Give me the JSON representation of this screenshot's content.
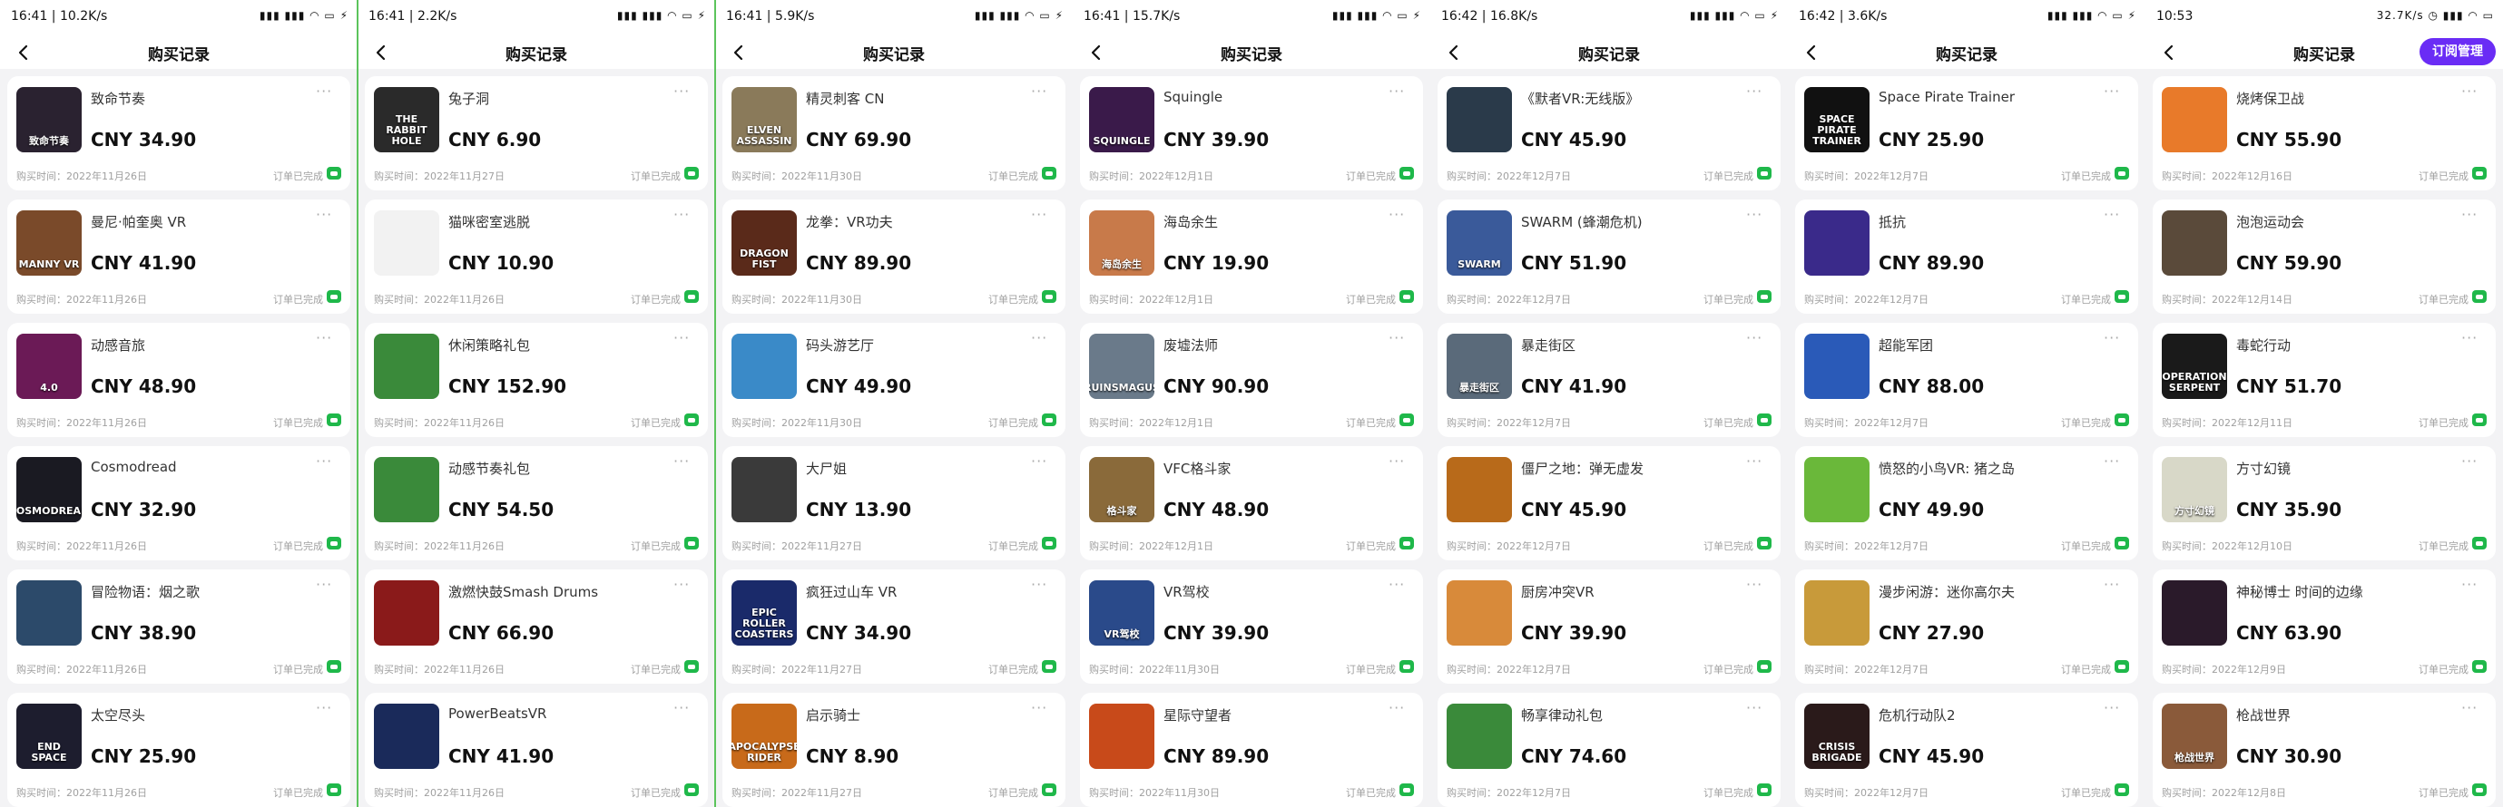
{
  "labels": {
    "page_title": "购买记录",
    "purchase_time_prefix": "购买时间：",
    "order_status": "订单已完成",
    "subscription_button": "订阅管理"
  },
  "colors": {
    "accent_purple": "#6a2cf5",
    "status_green": "#1fb84a",
    "divider_green": "#5cc45c"
  },
  "icons": {
    "back": "back-arrow-icon",
    "more": "more-dots-icon",
    "order_status": "chat-bubble-icon"
  },
  "screens": [
    {
      "status_time": "16:41 | 10.2K/s",
      "status_icons": "▮▮▮ ▮▮▮ ◠ ▭ ⚡",
      "items": [
        {
          "name": "致命节奏",
          "price": "CNY 34.90",
          "date": "2022年11月26日",
          "thumb_text": "致命节奏",
          "thumb_bg": "#2a2230"
        },
        {
          "name": "曼尼·帕奎奥 VR",
          "price": "CNY 41.90",
          "date": "2022年11月26日",
          "thumb_text": "MANNY VR",
          "thumb_bg": "#7a4a2a"
        },
        {
          "name": "动感音旅",
          "price": "CNY 48.90",
          "date": "2022年11月26日",
          "thumb_text": "4.0",
          "thumb_bg": "#6b1a56"
        },
        {
          "name": "Cosmodread",
          "price": "CNY 32.90",
          "date": "2022年11月26日",
          "thumb_text": "COSMODREAD",
          "thumb_bg": "#1a1a22"
        },
        {
          "name": "冒险物语：烟之歌",
          "price": "CNY 38.90",
          "date": "2022年11月26日",
          "thumb_text": "",
          "thumb_bg": "#2c4a6a"
        },
        {
          "name": "太空尽头",
          "price": "CNY 25.90",
          "date": "2022年11月26日",
          "thumb_text": "END SPACE",
          "thumb_bg": "#1d1d2e"
        }
      ]
    },
    {
      "status_time": "16:41 | 2.2K/s",
      "status_icons": "▮▮▮ ▮▮▮ ◠ ▭ ⚡",
      "items": [
        {
          "name": "兔子洞",
          "price": "CNY 6.90",
          "date": "2022年11月27日",
          "thumb_text": "THE RABBIT HOLE",
          "thumb_bg": "#2a2a2a"
        },
        {
          "name": "猫咪密室逃脱",
          "price": "CNY 10.90",
          "date": "2022年11月26日",
          "thumb_text": "",
          "thumb_bg": "#f2f2f2"
        },
        {
          "name": "休闲策略礼包",
          "price": "CNY 152.90",
          "date": "2022年11月26日",
          "thumb_text": "",
          "thumb_bg": "#3a8a3a"
        },
        {
          "name": "动感节奏礼包",
          "price": "CNY 54.50",
          "date": "2022年11月26日",
          "thumb_text": "",
          "thumb_bg": "#3a8a3a"
        },
        {
          "name": "激燃快鼓Smash Drums",
          "price": "CNY 66.90",
          "date": "2022年11月26日",
          "thumb_text": "",
          "thumb_bg": "#8a1a1a"
        },
        {
          "name": "PowerBeatsVR",
          "price": "CNY 41.90",
          "date": "2022年11月26日",
          "thumb_text": "",
          "thumb_bg": "#1a2a5a"
        }
      ]
    },
    {
      "status_time": "16:41 | 5.9K/s",
      "status_icons": "▮▮▮ ▮▮▮ ◠ ▭ ⚡",
      "items": [
        {
          "name": "精灵刺客 CN",
          "price": "CNY 69.90",
          "date": "2022年11月30日",
          "thumb_text": "ELVEN ASSASSIN",
          "thumb_bg": "#8a7a5a"
        },
        {
          "name": "龙拳：VR功夫",
          "price": "CNY 89.90",
          "date": "2022年11月30日",
          "thumb_text": "DRAGON FIST",
          "thumb_bg": "#5a2a1a"
        },
        {
          "name": "码头游艺厅",
          "price": "CNY 49.90",
          "date": "2022年11月30日",
          "thumb_text": "",
          "thumb_bg": "#3a8ac8"
        },
        {
          "name": "大尸姐",
          "price": "CNY 13.90",
          "date": "2022年11月27日",
          "thumb_text": "",
          "thumb_bg": "#3a3a3a"
        },
        {
          "name": "疯狂过山车 VR",
          "price": "CNY 34.90",
          "date": "2022年11月27日",
          "thumb_text": "EPIC ROLLER COASTERS",
          "thumb_bg": "#1a2a6a"
        },
        {
          "name": "启示骑士",
          "price": "CNY 8.90",
          "date": "2022年11月27日",
          "thumb_text": "APOCALYPSE RIDER",
          "thumb_bg": "#c86a1a"
        }
      ]
    },
    {
      "status_time": "16:41 | 15.7K/s",
      "status_icons": "▮▮▮ ▮▮▮ ◠ ▭ ⚡",
      "items": [
        {
          "name": "Squingle",
          "price": "CNY 39.90",
          "date": "2022年12月1日",
          "thumb_text": "SQUINGLE",
          "thumb_bg": "#3a1a4a"
        },
        {
          "name": "海岛余生",
          "price": "CNY 19.90",
          "date": "2022年12月1日",
          "thumb_text": "海岛余生",
          "thumb_bg": "#c87a4a"
        },
        {
          "name": "废墟法师",
          "price": "CNY 90.90",
          "date": "2022年12月1日",
          "thumb_text": "RUINSMAGUS",
          "thumb_bg": "#6a7a8a"
        },
        {
          "name": "VFC格斗家",
          "price": "CNY 48.90",
          "date": "2022年12月1日",
          "thumb_text": "格斗家",
          "thumb_bg": "#8a6a3a"
        },
        {
          "name": "VR驾校",
          "price": "CNY 39.90",
          "date": "2022年11月30日",
          "thumb_text": "VR驾校",
          "thumb_bg": "#2a4a8a"
        },
        {
          "name": "星际守望者",
          "price": "CNY 89.90",
          "date": "2022年11月30日",
          "thumb_text": "",
          "thumb_bg": "#c84a1a"
        }
      ]
    },
    {
      "status_time": "16:42 | 16.8K/s",
      "status_icons": "▮▮▮ ▮▮▮ ◠ ▭ ⚡",
      "items": [
        {
          "name": "《默者VR:无线版》",
          "price": "CNY 45.90",
          "date": "2022年12月7日",
          "thumb_text": "",
          "thumb_bg": "#2a3a4a"
        },
        {
          "name": "SWARM (蜂潮危机)",
          "price": "CNY 51.90",
          "date": "2022年12月7日",
          "thumb_text": "SWARM",
          "thumb_bg": "#3a5a9a"
        },
        {
          "name": "暴走街区",
          "price": "CNY 41.90",
          "date": "2022年12月7日",
          "thumb_text": "暴走街区",
          "thumb_bg": "#5a6a7a"
        },
        {
          "name": "僵尸之地：弹无虚发",
          "price": "CNY 45.90",
          "date": "2022年12月7日",
          "thumb_text": "",
          "thumb_bg": "#b86a1a"
        },
        {
          "name": "厨房冲突VR",
          "price": "CNY 39.90",
          "date": "2022年12月7日",
          "thumb_text": "",
          "thumb_bg": "#d88a3a"
        },
        {
          "name": "畅享律动礼包",
          "price": "CNY 74.60",
          "date": "2022年12月7日",
          "thumb_text": "",
          "thumb_bg": "#3a8a3a"
        }
      ]
    },
    {
      "status_time": "16:42 | 3.6K/s",
      "status_icons": "▮▮▮ ▮▮▮ ◠ ▭ ⚡",
      "items": [
        {
          "name": "Space Pirate Trainer",
          "price": "CNY 25.90",
          "date": "2022年12月7日",
          "thumb_text": "SPACE PIRATE TRAINER",
          "thumb_bg": "#111111"
        },
        {
          "name": "抵抗",
          "price": "CNY 89.90",
          "date": "2022年12月7日",
          "thumb_text": "",
          "thumb_bg": "#3a2a8a"
        },
        {
          "name": "超能军团",
          "price": "CNY 88.00",
          "date": "2022年12月7日",
          "thumb_text": "",
          "thumb_bg": "#2a5ab8"
        },
        {
          "name": "愤怒的小鸟VR: 猪之岛",
          "price": "CNY 49.90",
          "date": "2022年12月7日",
          "thumb_text": "",
          "thumb_bg": "#6ab83a"
        },
        {
          "name": "漫步闲游：迷你高尔夫",
          "price": "CNY 27.90",
          "date": "2022年12月7日",
          "thumb_text": "",
          "thumb_bg": "#c89a3a"
        },
        {
          "name": "危机行动队2",
          "price": "CNY 45.90",
          "date": "2022年12月7日",
          "thumb_text": "CRISIS BRIGADE",
          "thumb_bg": "#2a1a1a"
        }
      ]
    },
    {
      "status_time": "10:53",
      "status_icons": "32.7K/s ◷ ▮▮▮ ◠ ▭",
      "items": [
        {
          "name": "烧烤保卫战",
          "price": "CNY 55.90",
          "date": "2022年12月16日",
          "thumb_text": "",
          "thumb_bg": "#e87a2a"
        },
        {
          "name": "泡泡运动会",
          "price": "CNY 59.90",
          "date": "2022年12月14日",
          "thumb_text": "",
          "thumb_bg": "#5a4a3a"
        },
        {
          "name": "毒蛇行动",
          "price": "CNY 51.70",
          "date": "2022年12月11日",
          "thumb_text": "OPERATION SERPENT",
          "thumb_bg": "#1a1a1a"
        },
        {
          "name": "方寸幻镜",
          "price": "CNY 35.90",
          "date": "2022年12月10日",
          "thumb_text": "方寸幻镜",
          "thumb_bg": "#d8d8c8"
        },
        {
          "name": "神秘博士 时间的边缘",
          "price": "CNY 63.90",
          "date": "2022年12月9日",
          "thumb_text": "",
          "thumb_bg": "#2a1a2a"
        },
        {
          "name": "枪战世界",
          "price": "CNY 30.90",
          "date": "2022年12月8日",
          "thumb_text": "枪战世界",
          "thumb_bg": "#8a5a3a"
        }
      ]
    }
  ]
}
